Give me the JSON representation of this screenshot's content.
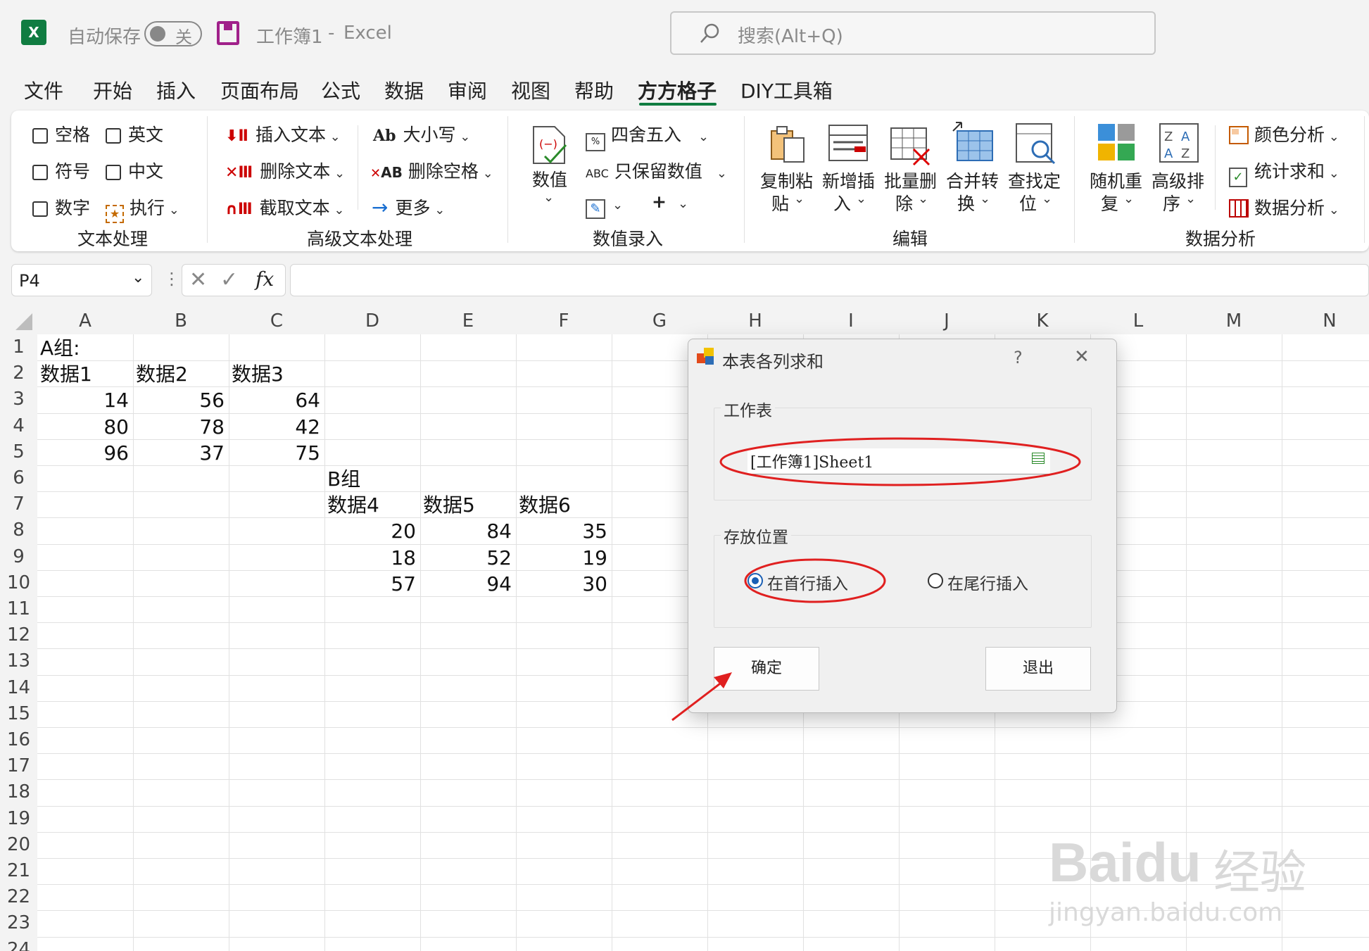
{
  "titlebar": {
    "app_icon": "X",
    "autosave_label": "自动保存",
    "autosave_state": "关",
    "doc_title": "工作簿1",
    "separator": "-",
    "app_name": "Excel",
    "search_placeholder": "搜索(Alt+Q)"
  },
  "menu": [
    "文件",
    "开始",
    "插入",
    "页面布局",
    "公式",
    "数据",
    "审阅",
    "视图",
    "帮助",
    "方方格子",
    "DIY工具箱"
  ],
  "ribbon": {
    "text_group": {
      "label": "文本处理",
      "checkboxes": [
        "空格",
        "英文",
        "符号",
        "中文",
        "数字"
      ],
      "execute": "执行"
    },
    "adv_text_group": {
      "label": "高级文本处理",
      "items": [
        "插入文本",
        "删除文本",
        "截取文本",
        "大小写",
        "删除空格",
        "更多"
      ],
      "icon_text": [
        "Ab",
        "AB"
      ]
    },
    "num_group": {
      "label": "数值录入",
      "big_button": "数值",
      "round": "四舍五入",
      "keep_num": "只保留数值",
      "abc": "ABC",
      "plus": "+"
    },
    "edit_group": {
      "label": "编辑",
      "buttons": [
        {
          "l1": "复制粘",
          "l2": "贴"
        },
        {
          "l1": "新增插",
          "l2": "入"
        },
        {
          "l1": "批量删",
          "l2": "除"
        },
        {
          "l1": "合并转",
          "l2": "换"
        },
        {
          "l1": "查找定",
          "l2": "位"
        }
      ]
    },
    "analysis_group": {
      "label": "数据分析",
      "buttons": [
        {
          "l1": "随机重",
          "l2": "复"
        },
        {
          "l1": "高级排",
          "l2": "序"
        }
      ],
      "items": [
        "颜色分析",
        "统计求和",
        "数据分析"
      ]
    }
  },
  "formula_bar": {
    "name_box": "P4",
    "fx": "fx",
    "formula": ""
  },
  "columns": [
    "A",
    "B",
    "C",
    "D",
    "E",
    "F",
    "G",
    "H",
    "I",
    "J",
    "K",
    "L",
    "M",
    "N"
  ],
  "rows": [
    "1",
    "2",
    "3",
    "4",
    "5",
    "6",
    "7",
    "8",
    "9",
    "10",
    "11",
    "12",
    "13",
    "14",
    "15",
    "16",
    "17",
    "18",
    "19",
    "20",
    "21",
    "22",
    "23",
    "24"
  ],
  "cells": {
    "A1": "A组:",
    "A2": "数据1",
    "B2": "数据2",
    "C2": "数据3",
    "A3": "14",
    "B3": "56",
    "C3": "64",
    "A4": "80",
    "B4": "78",
    "C4": "42",
    "A5": "96",
    "B5": "37",
    "C5": "75",
    "D6": "B组",
    "D7": "数据4",
    "E7": "数据5",
    "F7": "数据6",
    "D8": "20",
    "E8": "84",
    "F8": "35",
    "D9": "18",
    "E9": "52",
    "F9": "19",
    "D10": "57",
    "E10": "94",
    "F10": "30"
  },
  "dialog": {
    "title": "本表各列求和",
    "help": "?",
    "close": "✕",
    "worksheet_label": "工作表",
    "worksheet_value": "[工作簿1]Sheet1",
    "position_label": "存放位置",
    "option_top": "在首行插入",
    "option_bottom": "在尾行插入",
    "selected_option": "top",
    "ok": "确定",
    "exit": "退出"
  },
  "annotation_color": "#e02020",
  "watermark": {
    "brand": "Baidu",
    "suffix": "经验",
    "url": "jingyan.baidu.com"
  }
}
